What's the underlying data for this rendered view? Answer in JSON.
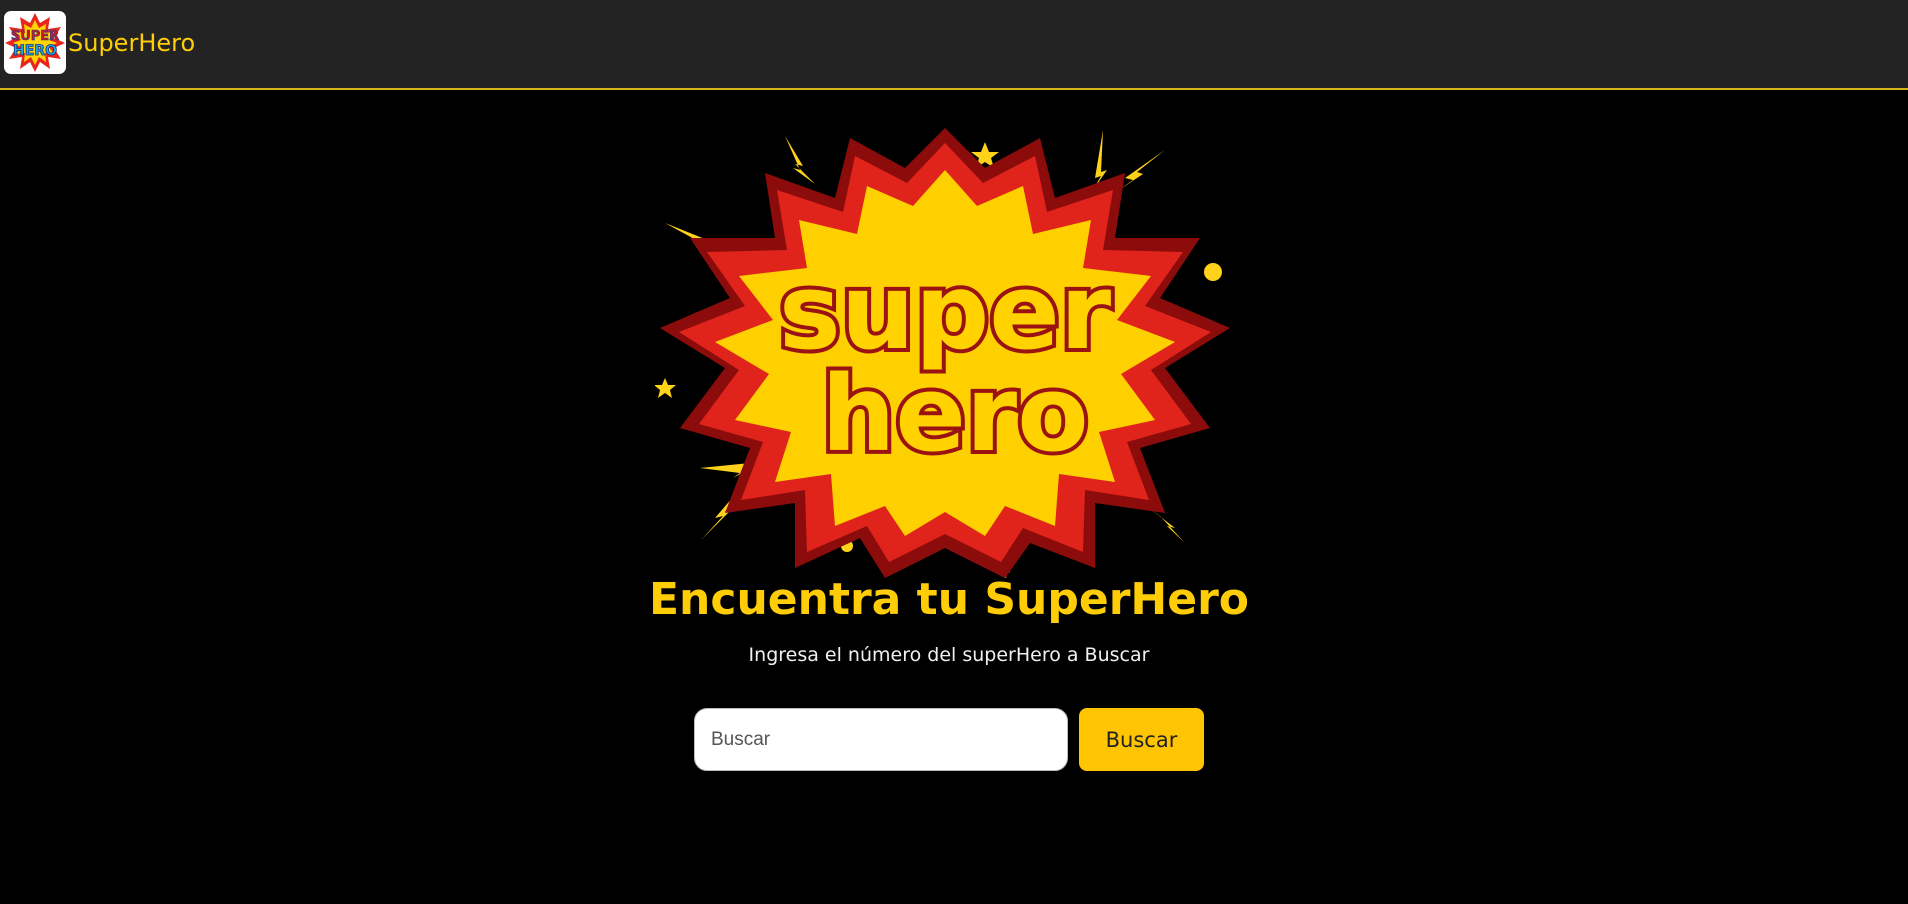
{
  "navbar": {
    "logo_text_top": "SUPER",
    "logo_text_bottom": "HERO",
    "brand": "SuperHero"
  },
  "hero": {
    "logo_line1": "super",
    "logo_line2": "hero"
  },
  "main": {
    "title": "Encuentra tu SuperHero",
    "subtitle": "Ingresa el número del superHero a Buscar"
  },
  "search": {
    "placeholder": "Buscar",
    "value": "",
    "button_label": "Buscar"
  },
  "colors": {
    "accent": "#ffcd07",
    "button": "#ffc502",
    "navbar_bg": "#232323",
    "page_bg": "#000000"
  }
}
